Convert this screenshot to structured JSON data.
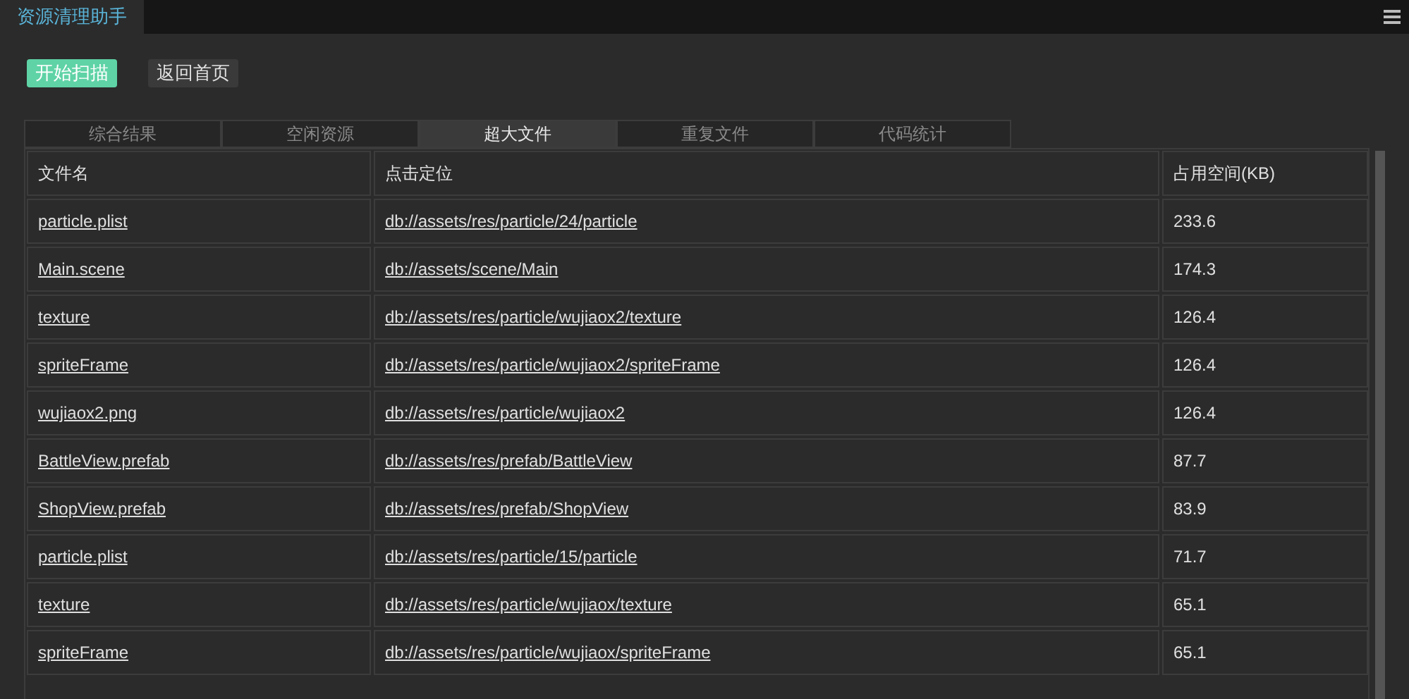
{
  "window": {
    "title": "资源清理助手"
  },
  "buttons": [
    {
      "label": "开始扫描",
      "kind": "primary"
    },
    {
      "label": "返回首页",
      "kind": "secondary"
    }
  ],
  "tabs": [
    {
      "label": "综合结果",
      "selected": false
    },
    {
      "label": "空闲资源",
      "selected": false
    },
    {
      "label": "超大文件",
      "selected": true
    },
    {
      "label": "重复文件",
      "selected": false
    },
    {
      "label": "代码统计",
      "selected": false
    }
  ],
  "table": {
    "columns": [
      "文件名",
      "点击定位",
      "占用空间(KB)"
    ],
    "rows": [
      [
        "particle.plist",
        "db://assets/res/particle/24/particle",
        "233.6"
      ],
      [
        "Main.scene",
        "db://assets/scene/Main",
        "174.3"
      ],
      [
        "texture",
        "db://assets/res/particle/wujiaox2/texture",
        "126.4"
      ],
      [
        "spriteFrame",
        "db://assets/res/particle/wujiaox2/spriteFrame",
        "126.4"
      ],
      [
        "wujiaox2.png",
        "db://assets/res/particle/wujiaox2",
        "126.4"
      ],
      [
        "BattleView.prefab",
        "db://assets/res/prefab/BattleView",
        "87.7"
      ],
      [
        "ShopView.prefab",
        "db://assets/res/prefab/ShopView",
        "83.9"
      ],
      [
        "particle.plist",
        "db://assets/res/particle/15/particle",
        "71.7"
      ],
      [
        "texture",
        "db://assets/res/particle/wujiaox/texture",
        "65.1"
      ],
      [
        "spriteFrame",
        "db://assets/res/particle/wujiaox/spriteFrame",
        "65.1"
      ]
    ]
  }
}
